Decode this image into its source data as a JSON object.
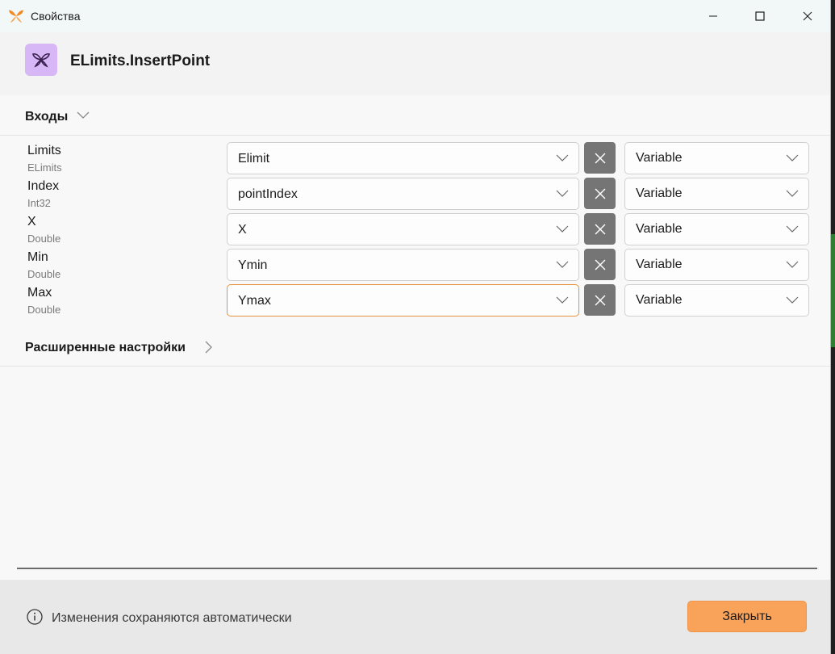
{
  "window": {
    "title": "Свойства"
  },
  "header": {
    "activity_title": "ELimits.InsertPoint",
    "icon": "butterfly-icon"
  },
  "inputs_section": {
    "title": "Входы",
    "expanded": true,
    "params": [
      {
        "name": "Limits",
        "type": "ELimits",
        "value": "Elimit",
        "mode": "Variable"
      },
      {
        "name": "Index",
        "type": "Int32",
        "value": "pointIndex",
        "mode": "Variable"
      },
      {
        "name": "X",
        "type": "Double",
        "value": "X",
        "mode": "Variable"
      },
      {
        "name": "Min",
        "type": "Double",
        "value": "Ymin",
        "mode": "Variable"
      },
      {
        "name": "Max",
        "type": "Double",
        "value": "Ymax",
        "mode": "Variable"
      }
    ]
  },
  "advanced_section": {
    "title": "Расширенные настройки",
    "expanded": false
  },
  "footer": {
    "info_text": "Изменения сохраняются автоматически",
    "close_label": "Закрыть"
  },
  "colors": {
    "accent": "#f9a35a",
    "focus_border": "#e6923e",
    "icon_bg": "#d7b7f5",
    "clear_button": "#757575"
  }
}
